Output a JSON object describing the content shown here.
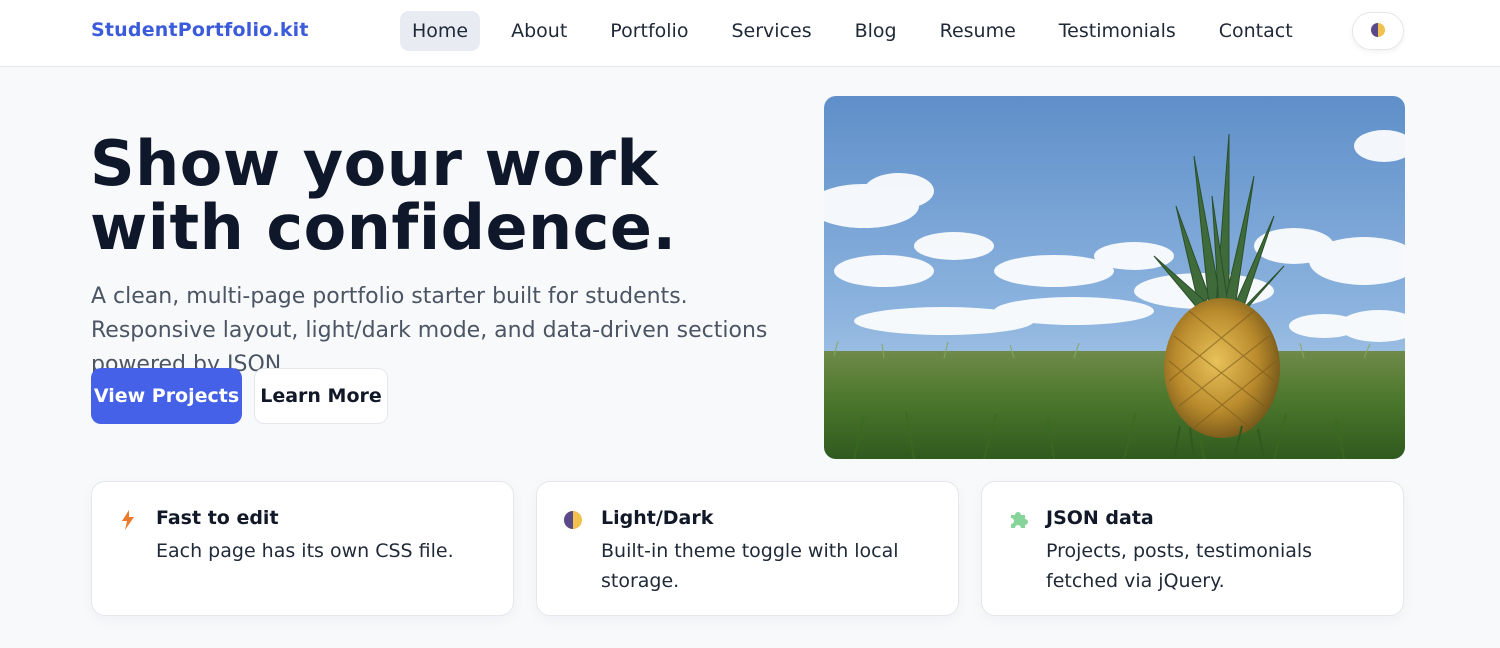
{
  "brand": "StudentPortfolio.kit",
  "nav": {
    "items": [
      {
        "label": "Home",
        "active": true
      },
      {
        "label": "About"
      },
      {
        "label": "Portfolio"
      },
      {
        "label": "Services"
      },
      {
        "label": "Blog"
      },
      {
        "label": "Resume"
      },
      {
        "label": "Testimonials"
      },
      {
        "label": "Contact"
      }
    ]
  },
  "theme_toggle": {
    "icon": "half-moon-icon"
  },
  "hero": {
    "title": "Show your work with confidence.",
    "subtitle": "A clean, multi-page portfolio starter built for students. Responsive layout, light/dark mode, and data-driven sections powered by JSON.",
    "primary_button": "View Projects",
    "secondary_button": "Learn More",
    "image": "pineapple-on-grass-photo"
  },
  "features": [
    {
      "icon": "lightning-icon",
      "title": "Fast to edit",
      "desc": "Each page has its own CSS file."
    },
    {
      "icon": "half-moon-icon",
      "title": "Light/Dark",
      "desc": "Built-in theme toggle with local storage."
    },
    {
      "icon": "puzzle-icon",
      "title": "JSON data",
      "desc": "Projects, posts, testimonials fetched via jQuery."
    }
  ],
  "colors": {
    "accent": "#4461e8",
    "brand": "#3b5bdb",
    "bolt": "#ea7a2c",
    "puzzle": "#86d49a"
  }
}
